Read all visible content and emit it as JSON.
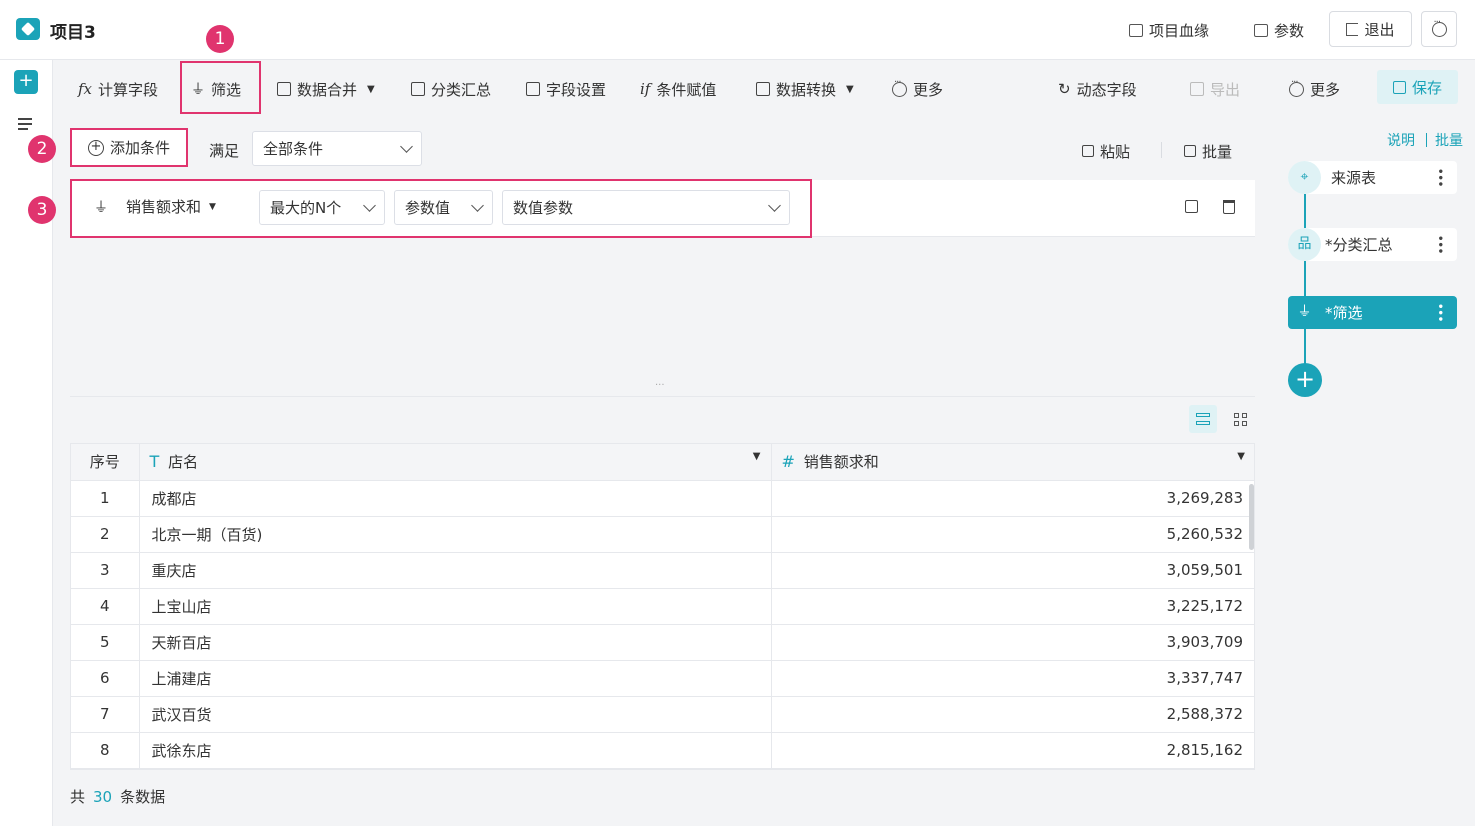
{
  "header": {
    "title": "项目3",
    "lineage_label": "项目血缘",
    "params_label": "参数",
    "exit_label": "退出"
  },
  "toolbar": {
    "calc_field": "计算字段",
    "filter": "筛选",
    "merge": "数据合并",
    "group_summary": "分类汇总",
    "field_settings": "字段设置",
    "cond_assign": "条件赋值",
    "transform": "数据转换",
    "more": "更多",
    "dynamic_field": "动态字段",
    "export": "导出",
    "more2": "更多",
    "save": "保存"
  },
  "filter": {
    "add_condition": "添加条件",
    "satisfy_label": "满足",
    "satisfy_value": "全部条件",
    "paste_label": "粘贴",
    "batch_label": "批量",
    "condition": {
      "field": "销售额求和",
      "operator": "最大的N个",
      "value_type": "参数值",
      "param": "数值参数"
    }
  },
  "badges": [
    "1",
    "2",
    "3"
  ],
  "table": {
    "columns": [
      "序号",
      "店名",
      "销售额求和"
    ],
    "column_types": [
      "",
      "T",
      "#"
    ],
    "rows": [
      [
        "1",
        "成都店",
        "3,269,283"
      ],
      [
        "2",
        "北京一期（百货)",
        "5,260,532"
      ],
      [
        "3",
        "重庆店",
        "3,059,501"
      ],
      [
        "4",
        "上宝山店",
        "3,225,172"
      ],
      [
        "5",
        "天新百店",
        "3,903,709"
      ],
      [
        "6",
        "上浦建店",
        "3,337,747"
      ],
      [
        "7",
        "武汉百货",
        "2,588,372"
      ],
      [
        "8",
        "武徐东店",
        "2,815,162"
      ]
    ]
  },
  "footer": {
    "prefix": "共",
    "count": "30",
    "suffix": "条数据"
  },
  "right_panel": {
    "explain_link": "说明",
    "batch_link": "批量",
    "nodes": [
      "来源表",
      "*分类汇总",
      "*筛选"
    ]
  },
  "colors": {
    "accent": "#1ba3b8",
    "highlight": "#e0346e"
  }
}
